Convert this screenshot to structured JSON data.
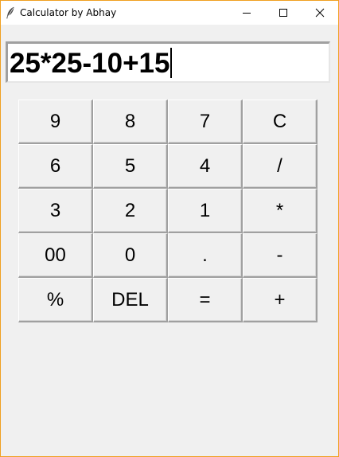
{
  "window": {
    "title": "Calculator by Abhay",
    "icon": "feather-icon",
    "controls": [
      "minimize-icon",
      "maximize-icon",
      "close-icon"
    ]
  },
  "display": {
    "value": "25*25-10+15"
  },
  "keypad": {
    "rows": [
      [
        "9",
        "8",
        "7",
        "C"
      ],
      [
        "6",
        "5",
        "4",
        "/"
      ],
      [
        "3",
        "2",
        "1",
        "*"
      ],
      [
        "00",
        "0",
        ".",
        "-"
      ],
      [
        "%",
        "DEL",
        "=",
        "+"
      ]
    ]
  }
}
